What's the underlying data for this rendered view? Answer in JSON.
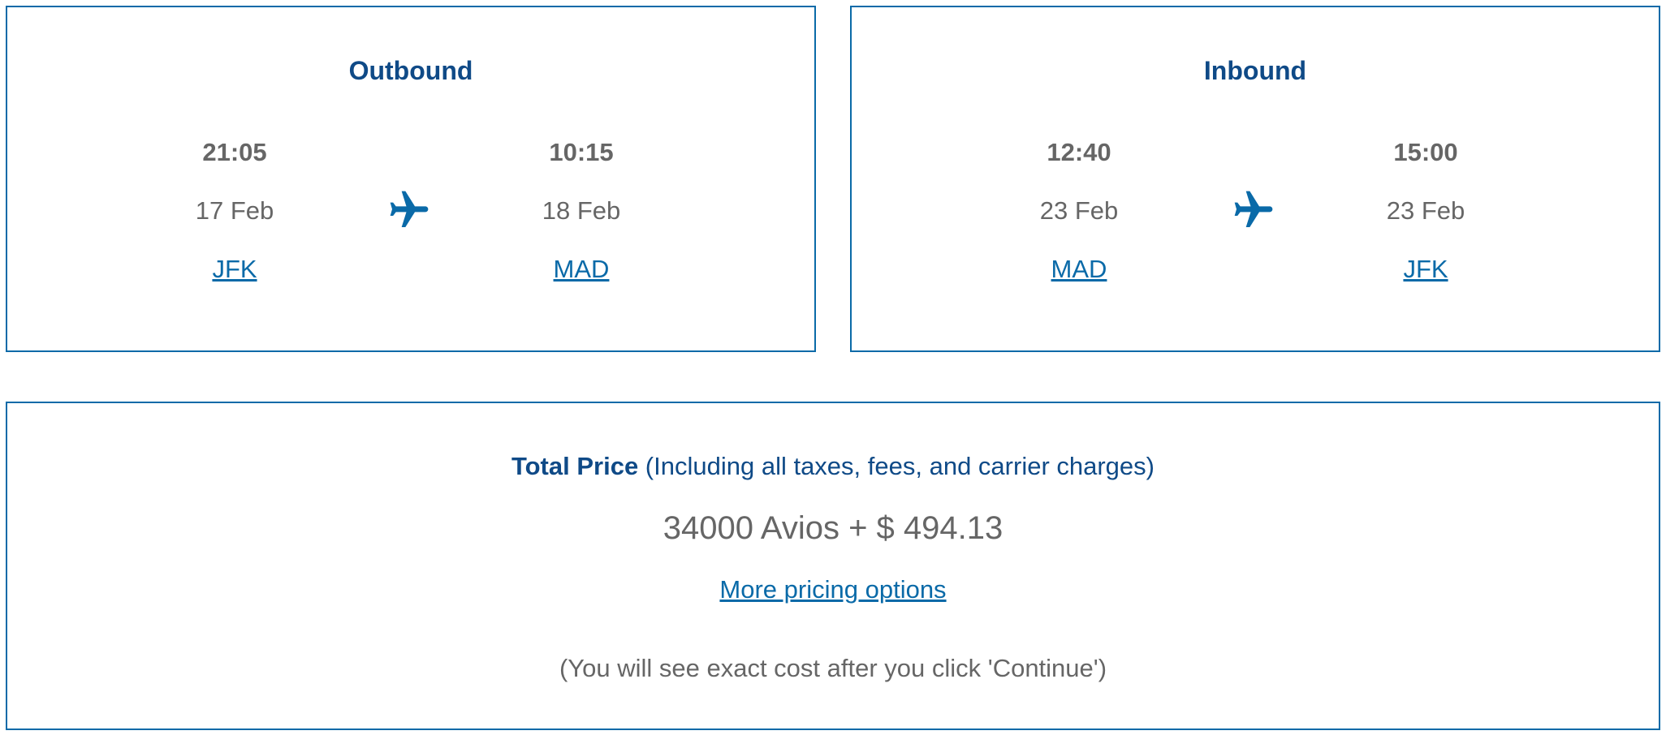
{
  "outbound": {
    "title": "Outbound",
    "departure": {
      "time": "21:05",
      "date": "17 Feb",
      "airport": "JFK"
    },
    "arrival": {
      "time": "10:15",
      "date": "18 Feb",
      "airport": "MAD"
    },
    "icon": "airplane-icon"
  },
  "inbound": {
    "title": "Inbound",
    "departure": {
      "time": "12:40",
      "date": "23 Feb",
      "airport": "MAD"
    },
    "arrival": {
      "time": "15:00",
      "date": "23 Feb",
      "airport": "JFK"
    },
    "icon": "airplane-icon"
  },
  "price": {
    "title_bold": "Total Price",
    "title_rest": " (Including all taxes, fees, and carrier charges)",
    "value": "34000 Avios + $ 494.13",
    "more_link": "More pricing options",
    "note": "(You will see exact cost after you click 'Continue')"
  },
  "colors": {
    "border": "#0a6aa8",
    "title": "#0f4a87",
    "link": "#0a6aa8",
    "text": "#666666"
  }
}
